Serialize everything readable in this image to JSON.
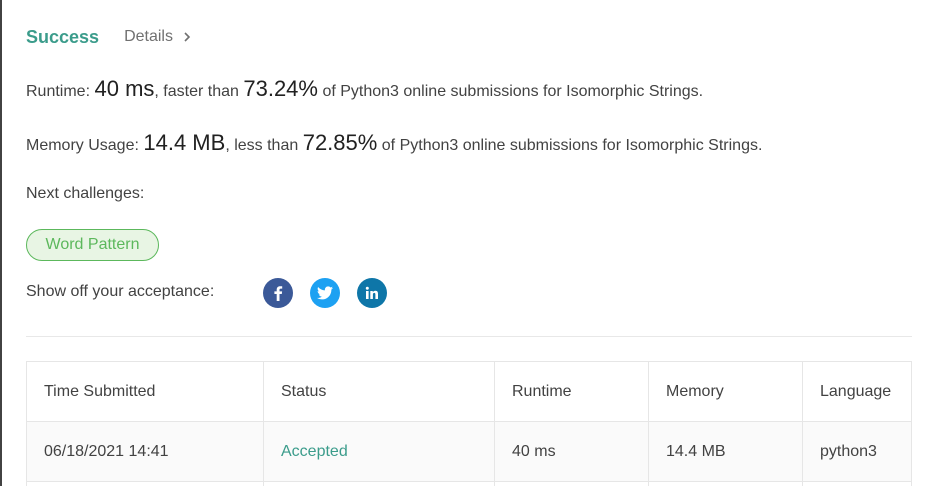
{
  "header": {
    "success_label": "Success",
    "details_label": "Details"
  },
  "runtime": {
    "label": "Runtime:",
    "value": "40 ms",
    "comparison": ", faster than",
    "percent": "73.24%",
    "suffix": "of Python3 online submissions for Isomorphic Strings."
  },
  "memory": {
    "label": "Memory Usage:",
    "value": "14.4 MB",
    "comparison": ", less than",
    "percent": "72.85%",
    "suffix": "of Python3 online submissions for Isomorphic Strings."
  },
  "next_challenges": {
    "label": "Next challenges:",
    "items": [
      {
        "label": "Word Pattern"
      }
    ]
  },
  "share": {
    "label": "Show off your acceptance:",
    "icons": [
      "facebook-icon",
      "twitter-icon",
      "linkedin-icon"
    ]
  },
  "submissions": {
    "headers": [
      "Time Submitted",
      "Status",
      "Runtime",
      "Memory",
      "Language"
    ],
    "rows": [
      {
        "time": "06/18/2021 14:41",
        "status": "Accepted",
        "runtime": "40 ms",
        "memory": "14.4 MB",
        "language": "python3"
      }
    ]
  },
  "colors": {
    "success": "#3b9c8b",
    "pill_border": "#5cb85c",
    "pill_bg": "#e8f5e4",
    "facebook": "#3b5998",
    "twitter": "#1da1f2",
    "linkedin": "#0e76a8"
  }
}
